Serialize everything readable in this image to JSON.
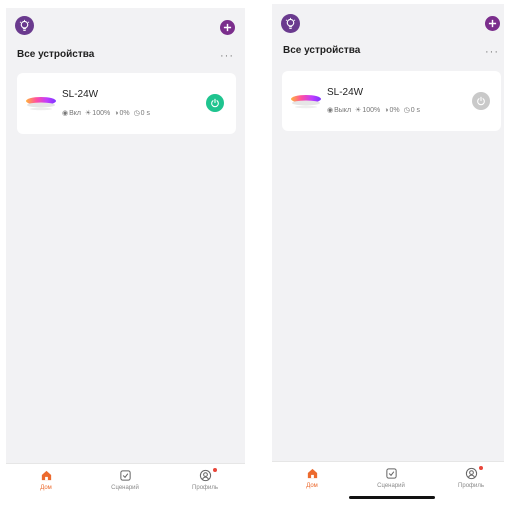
{
  "screens": [
    {
      "header": {
        "section_title": "Все устройства",
        "more_label": "···"
      },
      "device": {
        "name": "SL-24W",
        "power_state": "Вкл",
        "brightness": "100%",
        "saturation": "0%",
        "timer": "0 s",
        "power_on": true
      },
      "tabs": [
        {
          "label": "Дом",
          "active": true
        },
        {
          "label": "Сценарий",
          "active": false
        },
        {
          "label": "Профиль",
          "active": false
        }
      ]
    },
    {
      "header": {
        "section_title": "Все устройства",
        "more_label": "···"
      },
      "device": {
        "name": "SL-24W",
        "power_state": "Выкл",
        "brightness": "100%",
        "saturation": "0%",
        "timer": "0 s",
        "power_on": false
      },
      "tabs": [
        {
          "label": "Дом",
          "active": true
        },
        {
          "label": "Сценарий",
          "active": false
        },
        {
          "label": "Профиль",
          "active": false
        }
      ]
    }
  ],
  "colors": {
    "brand_purple": "#7b2e8c",
    "power_on": "#1fc48f",
    "power_off": "#c9c9c9",
    "tab_active": "#ec6a2e",
    "tab_inactive": "#8a8a8a",
    "badge": "#e8463a",
    "background": "#f2f2f4"
  }
}
